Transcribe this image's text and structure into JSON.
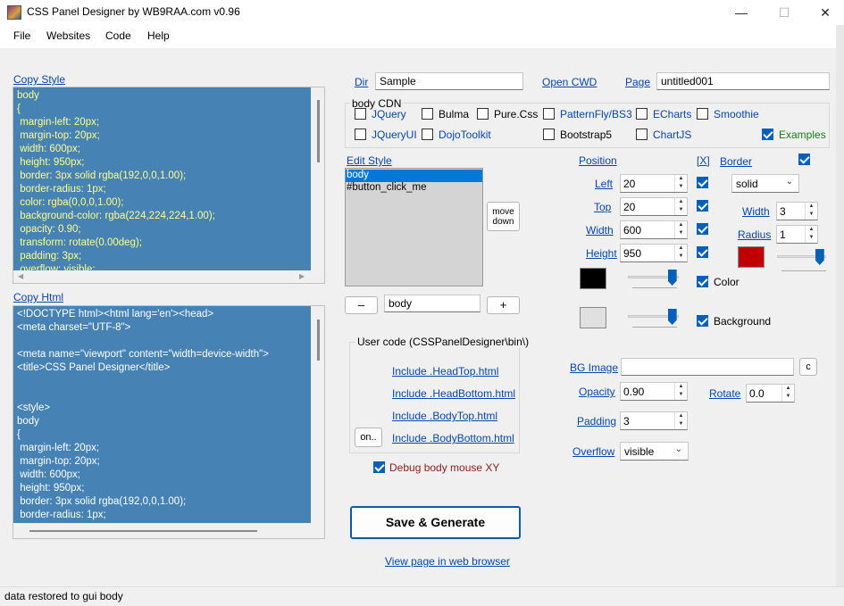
{
  "window": {
    "title": "CSS Panel Designer by WB9RAA.com  v0.96",
    "minimize": "—",
    "maximize": "☐",
    "close": "✕"
  },
  "menu": {
    "file": "File",
    "websites": "Websites",
    "code": "Code",
    "help": "Help"
  },
  "left": {
    "copy_style": "Copy Style",
    "style_code": "body\n{\n margin-left: 20px;\n margin-top: 20px;\n width: 600px;\n height: 950px;\n border: 3px solid rgba(192,0,0,1.00);\n border-radius: 1px;\n color: rgba(0,0,0,1.00);\n background-color: rgba(224,224,224,1.00);\n opacity: 0.90;\n transform: rotate(0.00deg);\n padding: 3px;\n overflow: visible;",
    "copy_html": "Copy Html",
    "html_code": "<!DOCTYPE html><html lang='en'><head>\n<meta charset=\"UTF-8\">\n\n<meta name=\"viewport\" content=\"width=device-width\">\n<title>CSS Panel Designer</title>\n\n\n<style>\nbody\n{\n margin-left: 20px;\n margin-top: 20px;\n width: 600px;\n height: 950px;\n border: 3px solid rgba(192,0,0,1.00);\n border-radius: 1px;"
  },
  "top": {
    "dir_label": "Dir",
    "dir_value": "Sample",
    "open_cwd": "Open CWD",
    "page_label": "Page",
    "page_value": "untitled001"
  },
  "cdn": {
    "title": "body CDN",
    "items": [
      {
        "label": "JQuery",
        "checked": false,
        "style": "link"
      },
      {
        "label": "Bulma",
        "checked": false,
        "style": "plain"
      },
      {
        "label": "Pure.Css",
        "checked": false,
        "style": "plain"
      },
      {
        "label": "PatternFly/BS3",
        "checked": false,
        "style": "link"
      },
      {
        "label": "ECharts",
        "checked": false,
        "style": "link"
      },
      {
        "label": "Smoothie",
        "checked": false,
        "style": "link"
      },
      {
        "label": "JQueryUI",
        "checked": false,
        "style": "link"
      },
      {
        "label": "DojoToolkit",
        "checked": false,
        "style": "link"
      },
      {
        "label": "Bootstrap5",
        "checked": false,
        "style": "plain"
      },
      {
        "label": "ChartJS",
        "checked": false,
        "style": "link"
      },
      {
        "label": "Examples",
        "checked": true,
        "style": "green"
      }
    ]
  },
  "edit": {
    "label": "Edit Style",
    "items": [
      "body",
      "#button_click_me"
    ],
    "selected": "body",
    "move_down": "move\ndown",
    "minus": "–",
    "plus": "+",
    "name_value": "body"
  },
  "user_code": {
    "title": "User code (CSSPanelDesigner\\bin\\)",
    "links": [
      "Include .HeadTop.html",
      "Include .HeadBottom.html",
      "Include .BodyTop.html",
      "Include .BodyBottom.html"
    ],
    "on_button": "on.."
  },
  "debug": {
    "label": "Debug body mouse XY",
    "checked": true
  },
  "save_button": "Save & Generate",
  "view_link": "View page in web browser",
  "position": {
    "label": "Position",
    "x_label": "[X]",
    "left_label": "Left",
    "left_value": "20",
    "top_label": "Top",
    "top_value": "20",
    "width_label": "Width",
    "width_value": "600",
    "height_label": "Height",
    "height_value": "950"
  },
  "border": {
    "label": "Border",
    "style_value": "solid",
    "width_label": "Width",
    "width_value": "3",
    "radius_label": "Radius",
    "radius_value": "1",
    "color": "#c00000",
    "slider_level": 0.95
  },
  "color": {
    "label": "Color",
    "swatch": "#000000",
    "slider_level": 0.95
  },
  "background": {
    "label": "Background",
    "swatch": "#e0e0e0",
    "slider_level": 0.95
  },
  "bg_image": {
    "label": "BG Image",
    "value": "",
    "clear": "c"
  },
  "opacity": {
    "label": "Opacity",
    "value": "0.90"
  },
  "rotate": {
    "label": "Rotate",
    "value": "0.0"
  },
  "padding": {
    "label": "Padding",
    "value": "3"
  },
  "overflow": {
    "label": "Overflow",
    "value": "visible"
  },
  "status": "data restored to gui body",
  "icons": [
    "app-icon",
    "chevron-down-icon",
    "checkmark-icon",
    "spin-arrows-icon"
  ]
}
